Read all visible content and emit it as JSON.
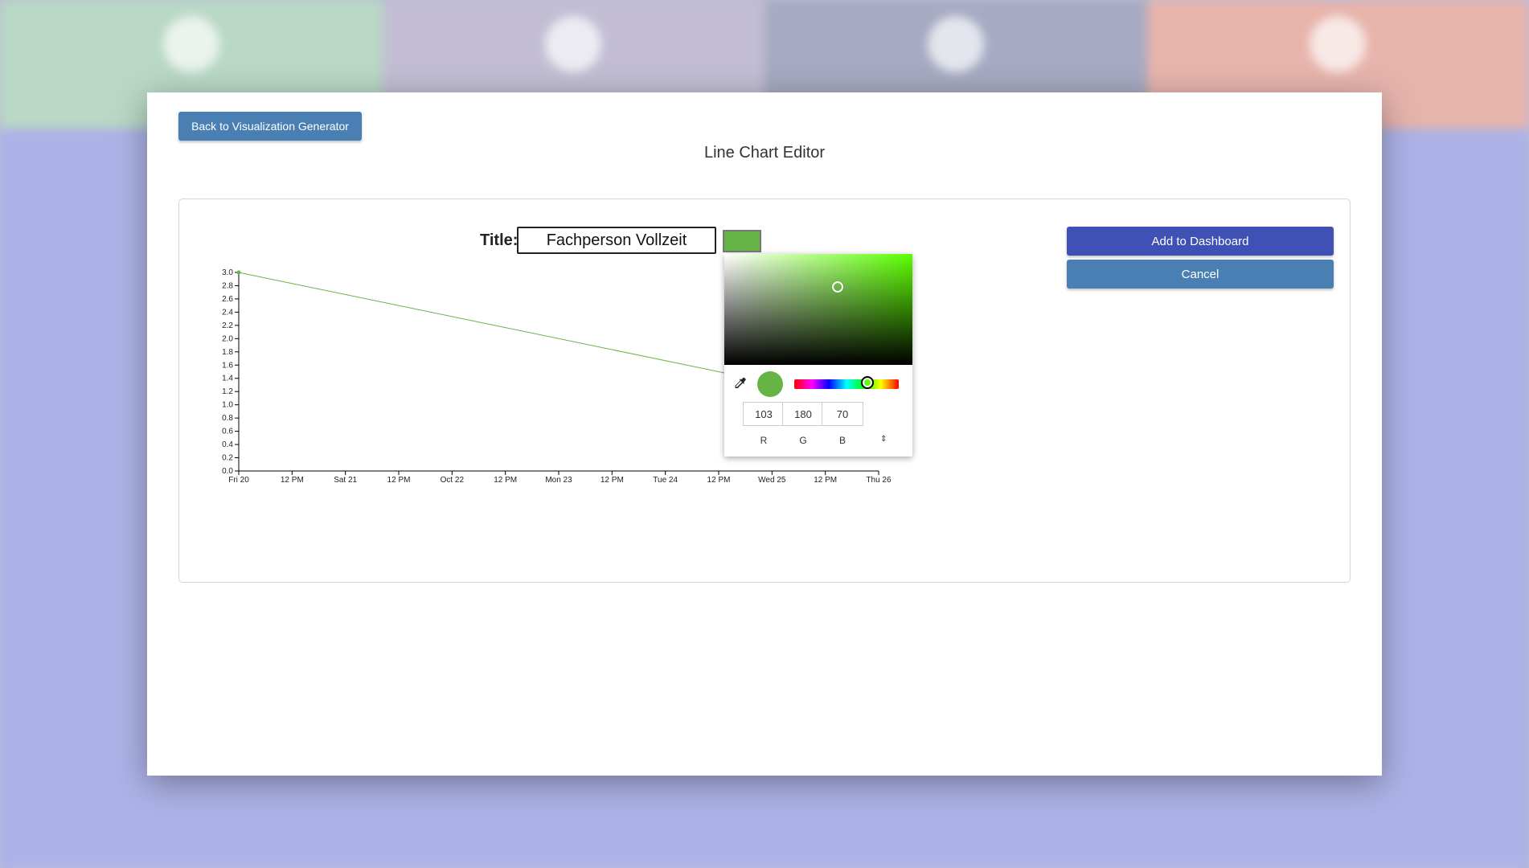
{
  "background": {
    "tile_colors": [
      "#b9d8c5",
      "#c2bdd4",
      "#a6aac2",
      "#e7b4ac"
    ]
  },
  "modal": {
    "back_label": "Back to Visualization Generator",
    "title": "Line Chart Editor"
  },
  "editor": {
    "title_label": "Title:",
    "title_value": "Fachperson Vollzeit",
    "add_label": "Add to Dashboard",
    "cancel_label": "Cancel"
  },
  "colors": {
    "accent_blue": "#4a7fb4",
    "add_button": "#3f51b5",
    "series": "#67b446"
  },
  "picker": {
    "selected_color": "#67b446",
    "hue_color": "#5dff00",
    "r": "103",
    "g": "180",
    "b": "70",
    "r_label": "R",
    "g_label": "G",
    "b_label": "B",
    "mode_toggle": "⇕",
    "eyedropper_icon": "eyedropper-icon"
  },
  "chart_data": {
    "type": "line",
    "x_ticks": [
      "Fri 20",
      "12 PM",
      "Sat 21",
      "12 PM",
      "Oct 22",
      "12 PM",
      "Mon 23",
      "12 PM",
      "Tue 24",
      "12 PM",
      "Wed 25",
      "12 PM",
      "Thu 26"
    ],
    "y_ticks": [
      "0.0",
      "0.2",
      "0.4",
      "0.6",
      "0.8",
      "1.0",
      "1.2",
      "1.4",
      "1.6",
      "1.8",
      "2.0",
      "2.2",
      "2.4",
      "2.6",
      "2.8",
      "3.0"
    ],
    "ylim": [
      0,
      3
    ],
    "series": [
      {
        "color": "#67b446",
        "points": [
          {
            "x": "Fri 20",
            "y": 3
          },
          {
            "x": "Thu 26",
            "y": 1
          }
        ]
      }
    ],
    "grid": false
  }
}
